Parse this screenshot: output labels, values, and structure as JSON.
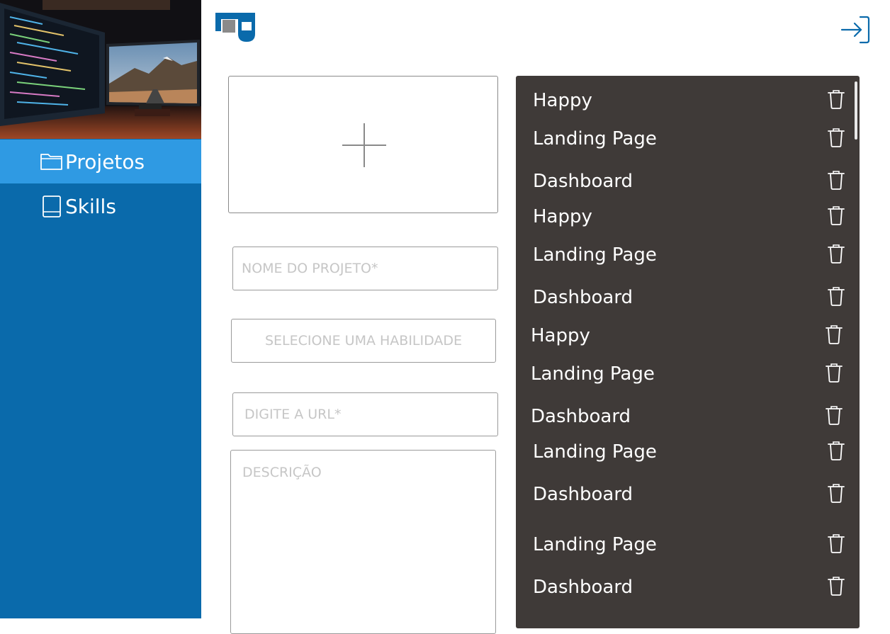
{
  "sidebar": {
    "items": [
      {
        "label": "Projetos",
        "icon": "folder-icon",
        "active": true
      },
      {
        "label": "Skills",
        "icon": "book-icon",
        "active": false
      }
    ]
  },
  "header": {
    "logo_icon": "logo-icon",
    "logout_icon": "logout-icon"
  },
  "form": {
    "upload_icon": "plus-icon",
    "name_placeholder": "NOME DO PROJETO*",
    "skill_placeholder": "SELECIONE UMA HABILIDADE",
    "url_placeholder": "DIGITE A URL*",
    "description_placeholder": "DESCRIÇÃO"
  },
  "projects": [
    {
      "name": "Happy"
    },
    {
      "name": "Landing Page"
    },
    {
      "name": "Dashboard"
    },
    {
      "name": "Happy"
    },
    {
      "name": "Landing Page"
    },
    {
      "name": "Dashboard"
    },
    {
      "name": "Happy"
    },
    {
      "name": "Landing Page"
    },
    {
      "name": "Dashboard"
    },
    {
      "name": "Landing Page"
    },
    {
      "name": "Dashboard"
    },
    {
      "name": "Landing Page"
    },
    {
      "name": "Dashboard"
    }
  ],
  "colors": {
    "sidebar": "#0a6aab",
    "sidebar_active": "#2f9ae3",
    "list_background": "#3f3a38",
    "accent": "#0a6aab"
  }
}
